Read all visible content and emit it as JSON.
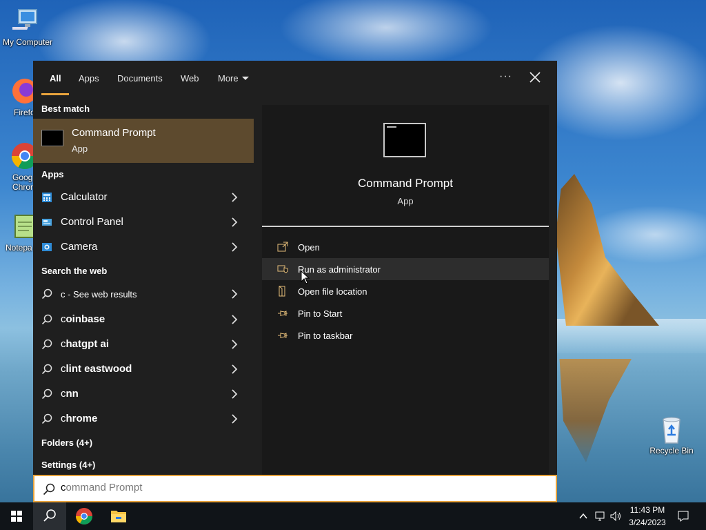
{
  "desktop": {
    "icons": [
      {
        "label": "My Computer"
      },
      {
        "label": "Firefo"
      },
      {
        "label": "Goog\nChror"
      },
      {
        "label": "Notepa"
      },
      {
        "label": "Recycle Bin"
      }
    ]
  },
  "search_panel": {
    "tabs": [
      "All",
      "Apps",
      "Documents",
      "Web",
      "More"
    ],
    "active_tab": "All",
    "more_options_icon": "ellipsis-icon",
    "close_icon": "close-icon",
    "sections": {
      "best_match": "Best match",
      "apps": "Apps",
      "search_web": "Search the web",
      "folders": "Folders (4+)",
      "settings": "Settings (4+)"
    },
    "best_match": {
      "title": "Command Prompt",
      "subtitle": "App"
    },
    "apps": [
      {
        "label": "Calculator",
        "icon": "calculator-icon"
      },
      {
        "label": "Control Panel",
        "icon": "control-panel-icon"
      },
      {
        "label": "Camera",
        "icon": "camera-icon"
      }
    ],
    "web_results": [
      {
        "prefix": "c",
        "suffix": " - See web results"
      },
      {
        "prefix": "c",
        "suffix": "oinbase"
      },
      {
        "prefix": "c",
        "suffix": "hatgpt ai"
      },
      {
        "prefix": "c",
        "suffix": "lint eastwood"
      },
      {
        "prefix": "c",
        "suffix": "nn"
      },
      {
        "prefix": "c",
        "suffix": "hrome"
      }
    ],
    "detail": {
      "title": "Command Prompt",
      "subtitle": "App",
      "actions": [
        {
          "label": "Open",
          "icon": "open-icon"
        },
        {
          "label": "Run as administrator",
          "icon": "shield-icon"
        },
        {
          "label": "Open file location",
          "icon": "folder-icon"
        },
        {
          "label": "Pin to Start",
          "icon": "pin-icon"
        },
        {
          "label": "Pin to taskbar",
          "icon": "pin-icon"
        }
      ],
      "hovered_action": "Run as administrator"
    }
  },
  "search_box": {
    "typed": "c",
    "placeholder": "ommand Prompt",
    "value": ""
  },
  "taskbar": {
    "time": "11:43 PM",
    "date": "3/24/2023"
  },
  "colors": {
    "accent": "#e8a33c",
    "best_match_bg": "#5d4a2e",
    "panel_bg": "#1f1f1f"
  }
}
